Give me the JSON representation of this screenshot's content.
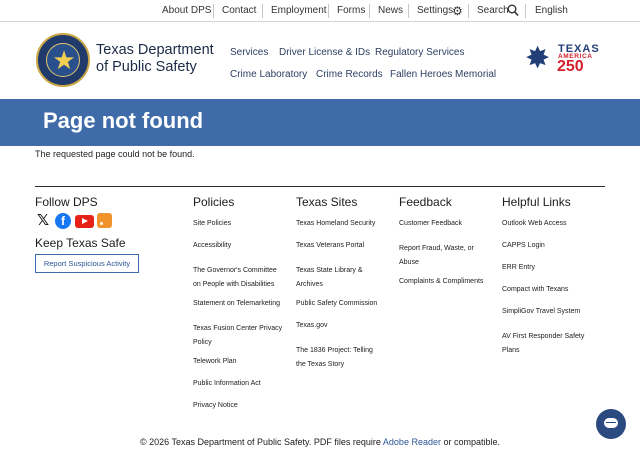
{
  "utility_nav": {
    "items": [
      "About DPS",
      "Contact",
      "Employment",
      "Forms",
      "News",
      "Settings",
      "Search",
      "English"
    ]
  },
  "header": {
    "agency_line1": "Texas Department",
    "agency_line2": "of Public Safety",
    "nav_row1": [
      "Services",
      "Driver License & IDs",
      "Regulatory Services"
    ],
    "nav_row2": [
      "Crime Laboratory",
      "Crime Records",
      "Fallen Heroes Memorial"
    ],
    "logo": {
      "line1": "TEXAS",
      "line2": "AMERICA",
      "line3": "250"
    }
  },
  "banner": {
    "title": "Page not found"
  },
  "message": "The requested page could not be found.",
  "footer": {
    "follow_heading": "Follow DPS",
    "keep_heading": "Keep Texas Safe",
    "report_button": "Report Suspicious Activity",
    "columns": [
      {
        "heading": "Policies",
        "links": [
          "Site Policies",
          "Accessibility",
          "The Governor's Committee on People with Disabilities",
          "Statement on Telemarketing",
          "Texas Fusion Center Privacy Policy",
          "Telework Plan",
          "Public Information Act",
          "Privacy Notice"
        ]
      },
      {
        "heading": "Texas Sites",
        "links": [
          "Texas Homeland Security",
          "Texas Veterans Portal",
          "Texas State Library & Archives",
          "Public Safety Commission",
          "Texas.gov",
          "The 1836 Project: Telling the Texas Story"
        ]
      },
      {
        "heading": "Feedback",
        "links": [
          "Customer Feedback",
          "Report Fraud, Waste, or Abuse",
          "Complaints & Compliments"
        ]
      },
      {
        "heading": "Helpful Links",
        "links": [
          "Outlook Web Access",
          "CAPPS Login",
          "ERR Entry",
          "Compact with Texans",
          "SimpliGov Travel System",
          "AV First Responder Safety Plans"
        ]
      }
    ],
    "copyright_pre": "© 2026 Texas Department of Public Safety. PDF files require",
    "copyright_link": "Adobe Reader",
    "copyright_post": "or compatible."
  }
}
